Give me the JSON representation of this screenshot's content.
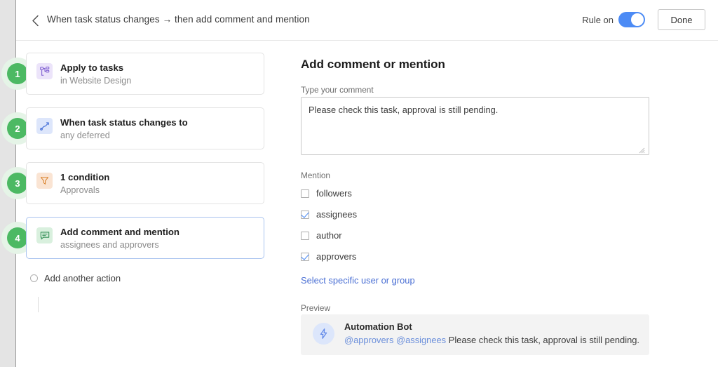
{
  "header": {
    "back_icon": "chevron-left-icon",
    "title": "When task status changes → then add comment and mention",
    "rule_toggle_label": "Rule on",
    "rule_toggle_state": "on",
    "done_label": "Done"
  },
  "steps": [
    {
      "number": "1",
      "icon": "hierarchy-icon",
      "icon_bg": "#ece4fa",
      "icon_color": "#7d5bd0",
      "title": "Apply to tasks",
      "subtitle": "in Website Design",
      "selected": false
    },
    {
      "number": "2",
      "icon": "trend-line-icon",
      "icon_bg": "#dde6fb",
      "icon_color": "#4670d8",
      "title": "When task status changes to",
      "subtitle": "any deferred",
      "selected": false
    },
    {
      "number": "3",
      "icon": "filter-funnel-icon",
      "icon_bg": "#fae4d3",
      "icon_color": "#d9822b",
      "title": "1 condition",
      "subtitle": "Approvals",
      "selected": false
    },
    {
      "number": "4",
      "icon": "comment-bubble-icon",
      "icon_bg": "#d9f0de",
      "icon_color": "#38915a",
      "title": "Add comment and mention",
      "subtitle": "assignees and approvers",
      "selected": true
    }
  ],
  "add_action": {
    "label": "Add another action",
    "icon": "circle-outline-icon"
  },
  "detail": {
    "title": "Add comment or mention",
    "comment_label": "Type your comment",
    "comment_value": "Please check this task, approval is still pending.",
    "comment_placeholder": "Type your comment",
    "mention_label": "Mention",
    "mention_options": [
      {
        "label": "followers",
        "checked": false
      },
      {
        "label": "assignees",
        "checked": true
      },
      {
        "label": "author",
        "checked": false
      },
      {
        "label": "approvers",
        "checked": true
      }
    ],
    "select_user_link": "Select specific user or group",
    "preview_label": "Preview",
    "preview": {
      "avatar_icon": "lightning-bolt-icon",
      "name": "Automation Bot",
      "mentions": "@approvers @assignees",
      "message": "Please check this task, approval is still pending."
    }
  },
  "colors": {
    "accent_blue": "#4c8bf5",
    "link_blue": "#4a6fd4",
    "badge_green": "#4cb963",
    "badge_halo": "#e5f4e7",
    "selected_border": "#a9c3ef"
  }
}
